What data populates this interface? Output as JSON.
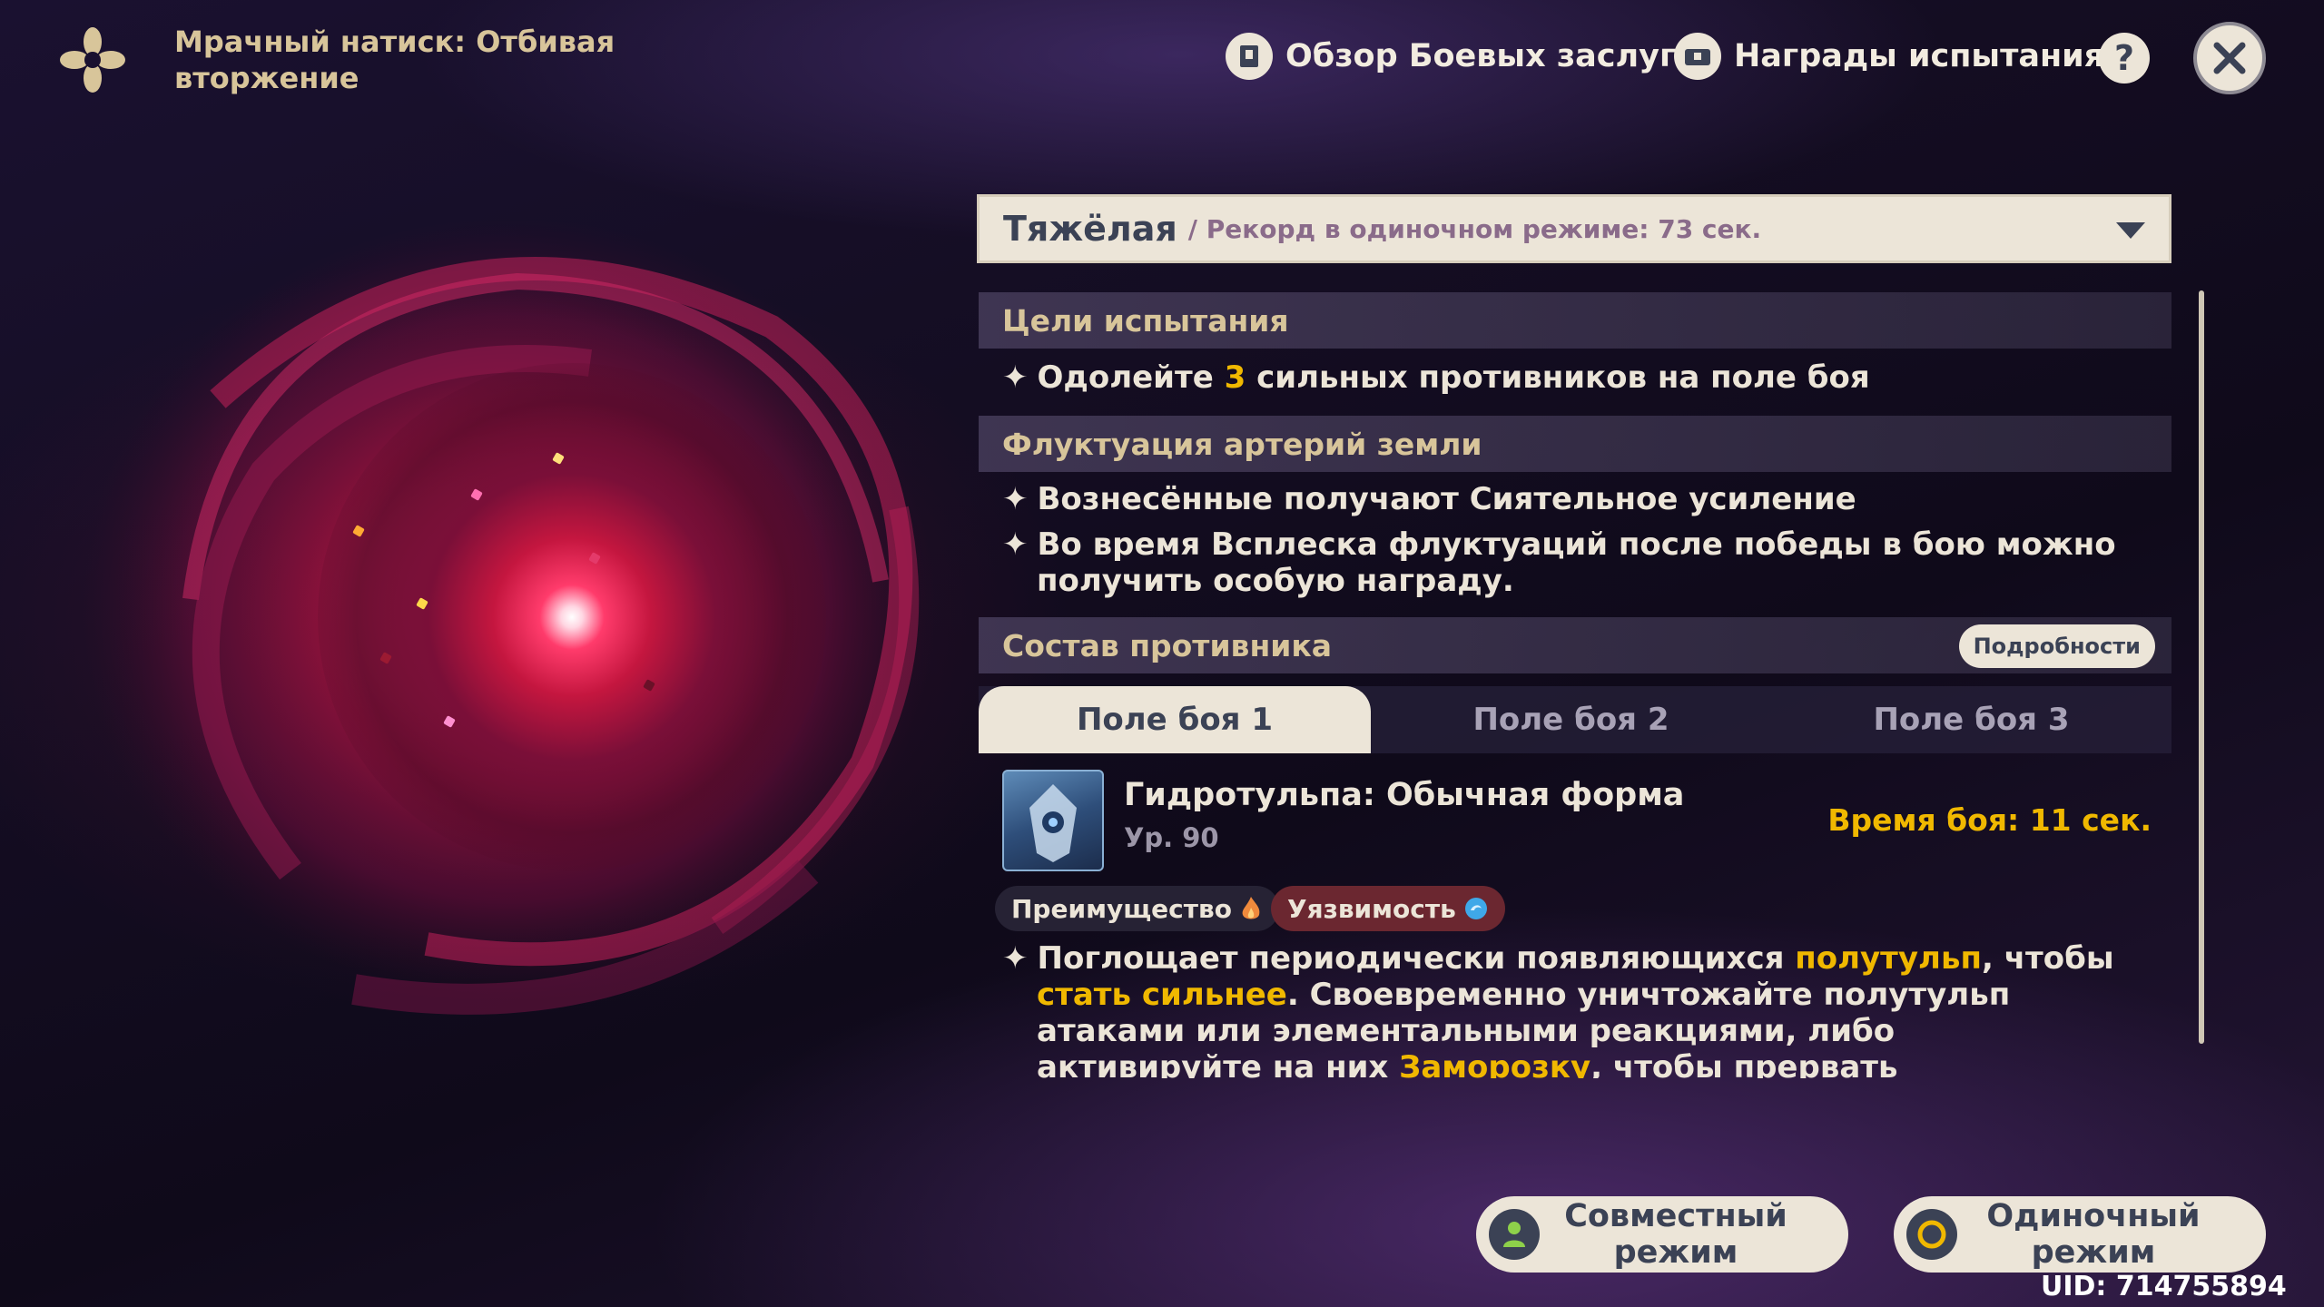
{
  "header": {
    "title": "Мрачный натиск: Отбивая вторжение",
    "battle_merits_label": "Обзор Боевых заслуг",
    "challenge_rewards_label": "Награды испытания",
    "help_label": "?"
  },
  "difficulty": {
    "level": "Тяжёлая",
    "record": "/ Рекорд в одиночном режиме: 73 сек."
  },
  "sections": {
    "objectives_title": "Цели испытания",
    "objective_pre": "Одолейте ",
    "objective_count": "3",
    "objective_post": " сильных противников на поле боя",
    "fluctuation_title": "Флуктуация артерий земли",
    "fluctuation_line1": "Вознесённые получают Сиятельное усиление",
    "fluctuation_line2": "Во время Всплеска флуктуаций после победы в бою можно получить особую награду.",
    "enemy_title": "Состав противника",
    "details_label": "Подробности"
  },
  "tabs": [
    "Поле боя 1",
    "Поле боя 2",
    "Поле боя 3"
  ],
  "enemy": {
    "name": "Гидротульпа: Обычная форма",
    "level": "Ур. 90",
    "battle_time": "Время боя: 11 сек.",
    "advantage_label": "Преимущество",
    "vulnerability_label": "Уязвимость",
    "desc_p1": "Поглощает периодически появляющихся ",
    "desc_hl1": "полутульп",
    "desc_p2": ", чтобы ",
    "desc_hl2": "стать сильнее",
    "desc_p3": ". Своевременно уничтожайте полутульп атаками или элементальными реакциями, либо активируйте на них ",
    "desc_hl3": "Заморозку",
    "desc_p4": ", чтобы прервать поглощение."
  },
  "modes": {
    "coop_label": "Совместный режим",
    "solo_label": "Одиночный режим"
  },
  "uid": "UID: 714755894",
  "colors": {
    "accent_gold": "#f0b800",
    "panel_light": "#ece5d8",
    "text_dark": "#3b4255"
  }
}
